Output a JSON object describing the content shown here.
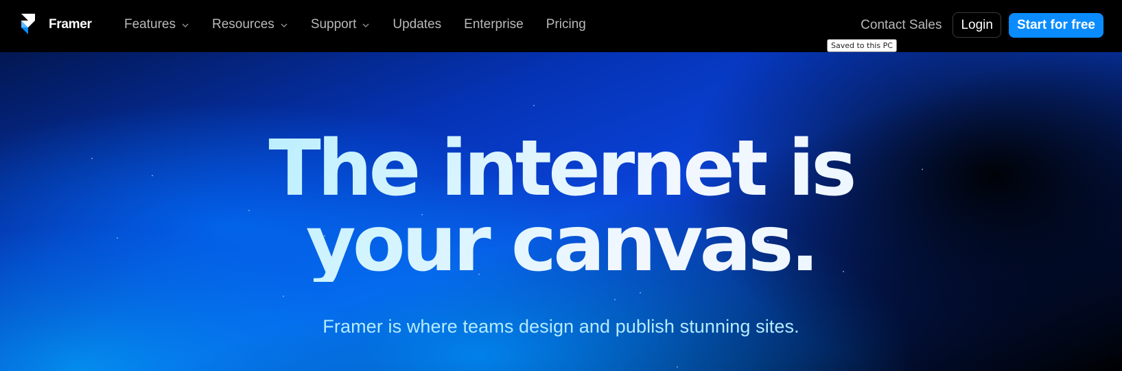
{
  "brand": {
    "name": "Framer",
    "accent": "#0a8cff"
  },
  "nav": {
    "items": [
      {
        "label": "Features",
        "icon": "chevron-down-icon"
      },
      {
        "label": "Resources",
        "icon": "chevron-down-icon"
      },
      {
        "label": "Support",
        "icon": "chevron-down-icon"
      },
      {
        "label": "Updates"
      },
      {
        "label": "Enterprise"
      },
      {
        "label": "Pricing"
      }
    ],
    "contact_label": "Contact Sales",
    "login_label": "Login",
    "start_label": "Start for free"
  },
  "tooltip": {
    "text": "Saved to this PC"
  },
  "hero": {
    "headline_line1": "The internet is",
    "headline_line2": "your canvas.",
    "subtitle": "Framer is where teams design and publish stunning sites."
  }
}
